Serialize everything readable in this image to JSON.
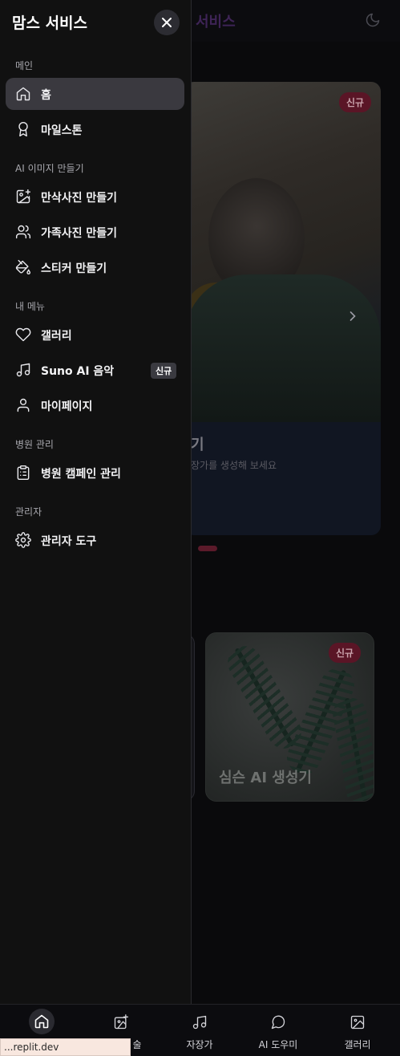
{
  "app": {
    "title": "맘스 서비스",
    "header_title_visible": "서비스"
  },
  "drawer": {
    "title": "맘스 서비스",
    "sections": [
      {
        "label": "메인",
        "items": [
          {
            "label": "홈",
            "icon": "home-icon",
            "active": true
          },
          {
            "label": "마일스톤",
            "icon": "award-icon"
          }
        ]
      },
      {
        "label": "AI 이미지 만들기",
        "items": [
          {
            "label": "만삭사진 만들기",
            "icon": "image-plus-icon"
          },
          {
            "label": "가족사진 만들기",
            "icon": "users-icon"
          },
          {
            "label": "스티커 만들기",
            "icon": "paint-bucket-icon"
          }
        ]
      },
      {
        "label": "내 메뉴",
        "items": [
          {
            "label": "갤러리",
            "icon": "heart-icon"
          },
          {
            "label": "Suno AI 음악",
            "icon": "music-icon",
            "badge": "신규"
          },
          {
            "label": "마이페이지",
            "icon": "user-icon"
          }
        ]
      },
      {
        "label": "병원 관리",
        "items": [
          {
            "label": "병원 캠페인 관리",
            "icon": "clipboard-icon"
          }
        ]
      },
      {
        "label": "관리자",
        "items": [
          {
            "label": "관리자 도구",
            "icon": "settings-icon"
          }
        ]
      }
    ]
  },
  "background": {
    "hero": {
      "badge": "신규",
      "title_fragment": "기",
      "subtitle_fragment": "장가를 생성해 보세요"
    },
    "card": {
      "badge": "신규",
      "title": "심슨 AI 생성기"
    }
  },
  "bottom_nav": [
    {
      "label": "",
      "icon": "home-icon",
      "active": true
    },
    {
      "label": "술",
      "icon": "image-plus-icon"
    },
    {
      "label": "자장가",
      "icon": "music-icon"
    },
    {
      "label": "AI 도우미",
      "icon": "chat-bubble-icon"
    },
    {
      "label": "갤러리",
      "icon": "image-icon"
    }
  ],
  "status_url": "...replit.dev",
  "colors": {
    "drawer_bg": "#111111",
    "active_item_bg": "#3a393f",
    "badge_bg": "#5a1526"
  }
}
